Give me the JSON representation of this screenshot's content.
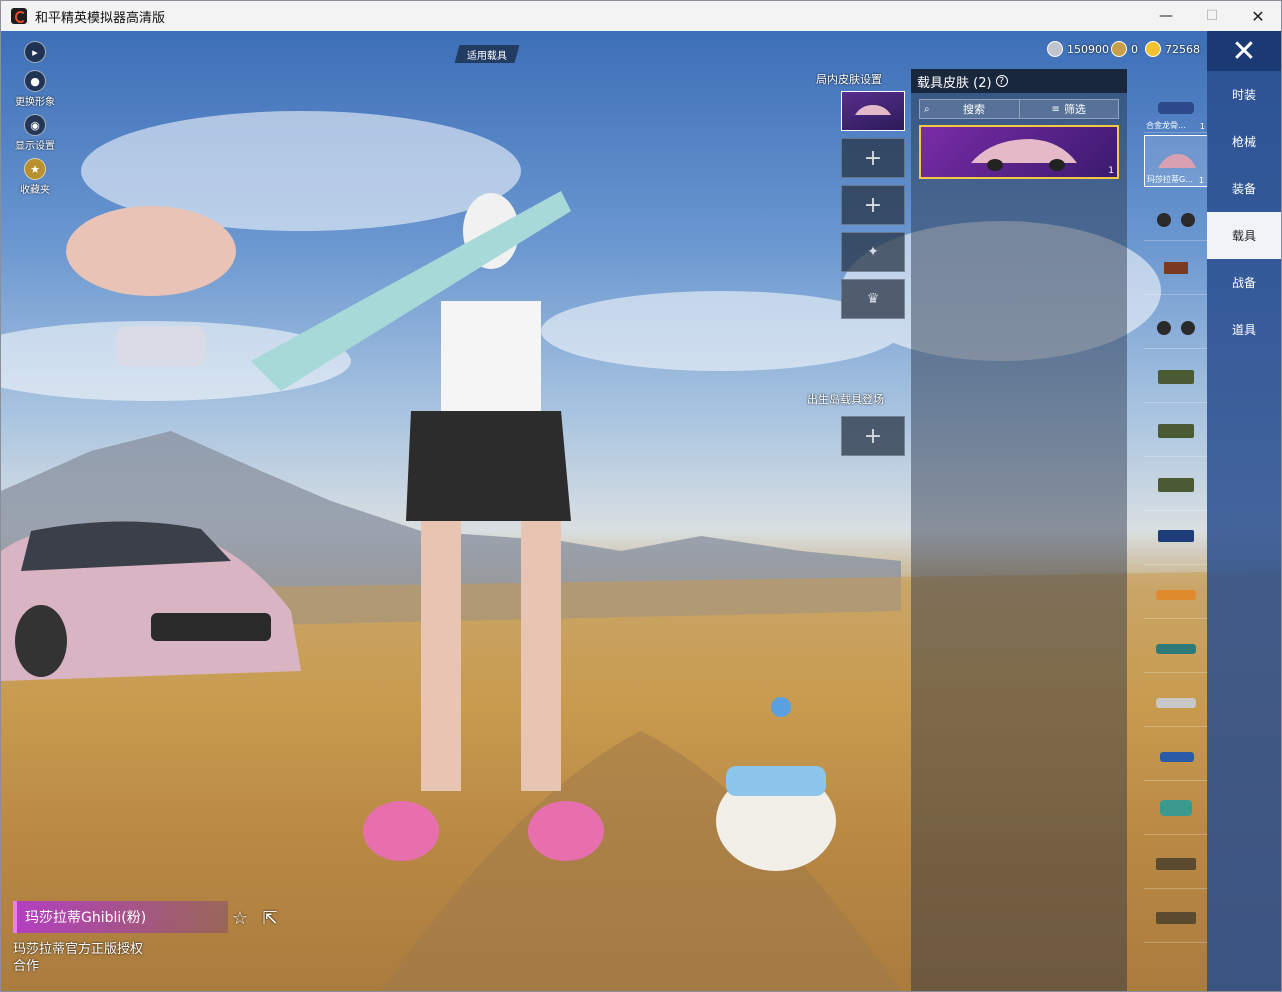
{
  "window": {
    "title": "和平精英模拟器高清版",
    "minimize": "—",
    "maximize": "☐",
    "close": "✕"
  },
  "left_tools": [
    {
      "icon": "play-arrow-icon",
      "label": ""
    },
    {
      "icon": "person-icon",
      "label": "更换形象"
    },
    {
      "icon": "eye-icon",
      "label": "显示设置"
    },
    {
      "icon": "collection-badge-icon",
      "label": "收藏夹"
    }
  ],
  "top_bar": {
    "vehicle_tag": "适用载具",
    "currencies": [
      {
        "icon": "silver-coin-icon",
        "value": "150900",
        "color": "#c0c4cc"
      },
      {
        "icon": "bronze-coin-icon",
        "value": "0",
        "color": "#c9a04a"
      },
      {
        "icon": "gold-coin-icon",
        "value": "72568",
        "color": "#f2c230"
      }
    ],
    "close": "✕"
  },
  "slots": {
    "ingame_header": "局内皮肤设置",
    "birth_header": "出生岛载具登场",
    "plus": "+"
  },
  "skin_panel": {
    "title": "载具皮肤 (2)",
    "help": "?",
    "search": "搜索",
    "filter": "筛选",
    "card_count": "1"
  },
  "categories": [
    {
      "label": "时装",
      "active": false
    },
    {
      "label": "枪械",
      "active": false
    },
    {
      "label": "装备",
      "active": false
    },
    {
      "label": "载具",
      "active": true
    },
    {
      "label": "战备",
      "active": false
    },
    {
      "label": "道具",
      "active": false
    }
  ],
  "vehicles": [
    {
      "name": "合金龙骨...",
      "count": "1",
      "color": "#2c4a8a"
    },
    {
      "name": "玛莎拉蒂G...",
      "count": "1",
      "color": "#d8a0b0"
    },
    {
      "name": "",
      "count": "",
      "color": "#2a2a2a"
    },
    {
      "name": "",
      "count": "",
      "color": "#7a3b22"
    },
    {
      "name": "",
      "count": "",
      "color": "#2a2a2a"
    },
    {
      "name": "",
      "count": "",
      "color": "#4a5a32"
    },
    {
      "name": "",
      "count": "",
      "color": "#4a5a32"
    },
    {
      "name": "",
      "count": "",
      "color": "#4a5a32"
    },
    {
      "name": "",
      "count": "",
      "color": "#1f3c7a"
    },
    {
      "name": "",
      "count": "",
      "color": "#e08a2e"
    },
    {
      "name": "",
      "count": "",
      "color": "#2e7a78"
    },
    {
      "name": "",
      "count": "",
      "color": "#c8c8c8"
    },
    {
      "name": "",
      "count": "",
      "color": "#2a5aa8"
    },
    {
      "name": "",
      "count": "",
      "color": "#3a9a8e"
    },
    {
      "name": "",
      "count": "",
      "color": "#5a4a2e"
    },
    {
      "name": "",
      "count": "",
      "color": "#5a4a2e"
    }
  ],
  "selected_item": {
    "name": "玛莎拉蒂Ghibli(粉)",
    "license": "玛莎拉蒂官方正版授权合作",
    "favorite": "☆",
    "share": "⇱"
  }
}
